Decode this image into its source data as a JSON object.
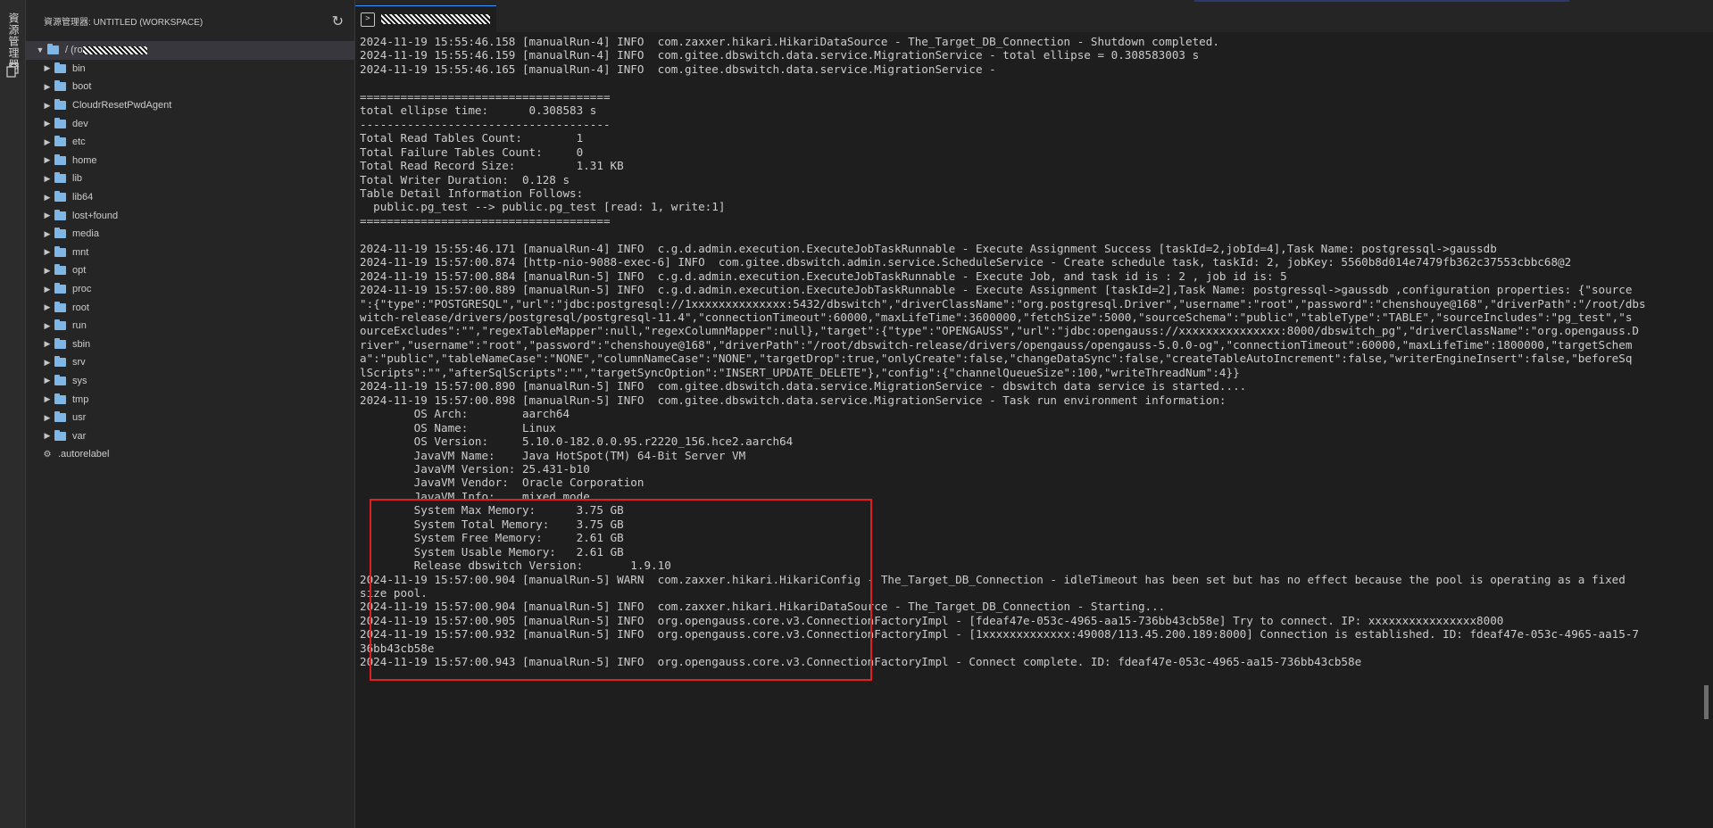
{
  "activity_bar": {
    "label": "資源管理器"
  },
  "sidebar": {
    "title": "資源管理器: UNTITLED (WORKSPACE)",
    "root_prefix": "/ (ro",
    "root_suffix": "",
    "items": [
      "bin",
      "boot",
      "CloudrResetPwdAgent",
      "dev",
      "etc",
      "home",
      "lib",
      "lib64",
      "lost+found",
      "media",
      "mnt",
      "opt",
      "proc",
      "root",
      "run",
      "sbin",
      "srv",
      "sys",
      "tmp",
      "usr",
      "var"
    ],
    "file": ".autorelabel"
  },
  "tab": {
    "label": ""
  },
  "terminal": {
    "lines": [
      "2024-11-19 15:55:46.158 [manualRun-4] INFO  com.zaxxer.hikari.HikariDataSource - The_Target_DB_Connection - Shutdown completed.",
      "2024-11-19 15:55:46.159 [manualRun-4] INFO  com.gitee.dbswitch.data.service.MigrationService - total ellipse = 0.308583003 s",
      "2024-11-19 15:55:46.165 [manualRun-4] INFO  com.gitee.dbswitch.data.service.MigrationService -",
      "",
      "=====================================",
      "total ellipse time:      0.308583 s",
      "-------------------------------------",
      "Total Read Tables Count:        1",
      "Total Failure Tables Count:     0",
      "Total Read Record Size:         1.31 KB",
      "Total Writer Duration:  0.128 s",
      "Table Detail Information Follows:",
      "  public.pg_test --> public.pg_test [read: 1, write:1]",
      "=====================================",
      "",
      "2024-11-19 15:55:46.171 [manualRun-4] INFO  c.g.d.admin.execution.ExecuteJobTaskRunnable - Execute Assignment Success [taskId=2,jobId=4],Task Name: postgressql->gaussdb",
      "2024-11-19 15:57:00.874 [http-nio-9088-exec-6] INFO  com.gitee.dbswitch.admin.service.ScheduleService - Create schedule task, taskId: 2, jobKey: 5560b8d014e7479fb362c37553cbbc68@2",
      "2024-11-19 15:57:00.884 [manualRun-5] INFO  c.g.d.admin.execution.ExecuteJobTaskRunnable - Execute Job, and task id is : 2 , job id is: 5",
      "2024-11-19 15:57:00.889 [manualRun-5] INFO  c.g.d.admin.execution.ExecuteJobTaskRunnable - Execute Assignment [taskId=2],Task Name: postgressql->gaussdb ,configuration properties: {\"source",
      "\":{\"type\":\"POSTGRESQL\",\"url\":\"jdbc:postgresql://1xxxxxxxxxxxxxx:5432/dbswitch\",\"driverClassName\":\"org.postgresql.Driver\",\"username\":\"root\",\"password\":\"chenshouye@168\",\"driverPath\":\"/root/dbs",
      "witch-release/drivers/postgresql/postgresql-11.4\",\"connectionTimeout\":60000,\"maxLifeTime\":3600000,\"fetchSize\":5000,\"sourceSchema\":\"public\",\"tableType\":\"TABLE\",\"sourceIncludes\":\"pg_test\",\"s",
      "ourceExcludes\":\"\",\"regexTableMapper\":null,\"regexColumnMapper\":null},\"target\":{\"type\":\"OPENGAUSS\",\"url\":\"jdbc:opengauss://xxxxxxxxxxxxxxx:8000/dbswitch_pg\",\"driverClassName\":\"org.opengauss.D",
      "river\",\"username\":\"root\",\"password\":\"chenshouye@168\",\"driverPath\":\"/root/dbswitch-release/drivers/opengauss/opengauss-5.0.0-og\",\"connectionTimeout\":60000,\"maxLifeTime\":1800000,\"targetSchem",
      "a\":\"public\",\"tableNameCase\":\"NONE\",\"columnNameCase\":\"NONE\",\"targetDrop\":true,\"onlyCreate\":false,\"changeDataSync\":false,\"createTableAutoIncrement\":false,\"writerEngineInsert\":false,\"beforeSq",
      "lScripts\":\"\",\"afterSqlScripts\":\"\",\"targetSyncOption\":\"INSERT_UPDATE_DELETE\"},\"config\":{\"channelQueueSize\":100,\"writeThreadNum\":4}}",
      "2024-11-19 15:57:00.890 [manualRun-5] INFO  com.gitee.dbswitch.data.service.MigrationService - dbswitch data service is started....",
      "2024-11-19 15:57:00.898 [manualRun-5] INFO  com.gitee.dbswitch.data.service.MigrationService - Task run environment information:",
      "        OS Arch:        aarch64",
      "        OS Name:        Linux",
      "        OS Version:     5.10.0-182.0.0.95.r2220_156.hce2.aarch64",
      "        JavaVM Name:    Java HotSpot(TM) 64-Bit Server VM",
      "        JavaVM Version: 25.431-b10",
      "        JavaVM Vendor:  Oracle Corporation",
      "        JavaVM Info:    mixed mode",
      "        System Max Memory:      3.75 GB",
      "        System Total Memory:    3.75 GB",
      "        System Free Memory:     2.61 GB",
      "        System Usable Memory:   2.61 GB",
      "        Release dbswitch Version:       1.9.10",
      "2024-11-19 15:57:00.904 [manualRun-5] WARN  com.zaxxer.hikari.HikariConfig - The_Target_DB_Connection - idleTimeout has been set but has no effect because the pool is operating as a fixed",
      "size pool.",
      "2024-11-19 15:57:00.904 [manualRun-5] INFO  com.zaxxer.hikari.HikariDataSource - The_Target_DB_Connection - Starting...",
      "2024-11-19 15:57:00.905 [manualRun-5] INFO  org.opengauss.core.v3.ConnectionFactoryImpl - [fdeaf47e-053c-4965-aa15-736bb43cb58e] Try to connect. IP: xxxxxxxxxxxxxxxx8000",
      "2024-11-19 15:57:00.932 [manualRun-5] INFO  org.opengauss.core.v3.ConnectionFactoryImpl - [1xxxxxxxxxxxxx:49008/113.45.200.189:8000] Connection is established. ID: fdeaf47e-053c-4965-aa15-7",
      "36bb43cb58e",
      "2024-11-19 15:57:00.943 [manualRun-5] INFO  org.opengauss.core.v3.ConnectionFactoryImpl - Connect complete. ID: fdeaf47e-053c-4965-aa15-736bb43cb58e"
    ]
  }
}
